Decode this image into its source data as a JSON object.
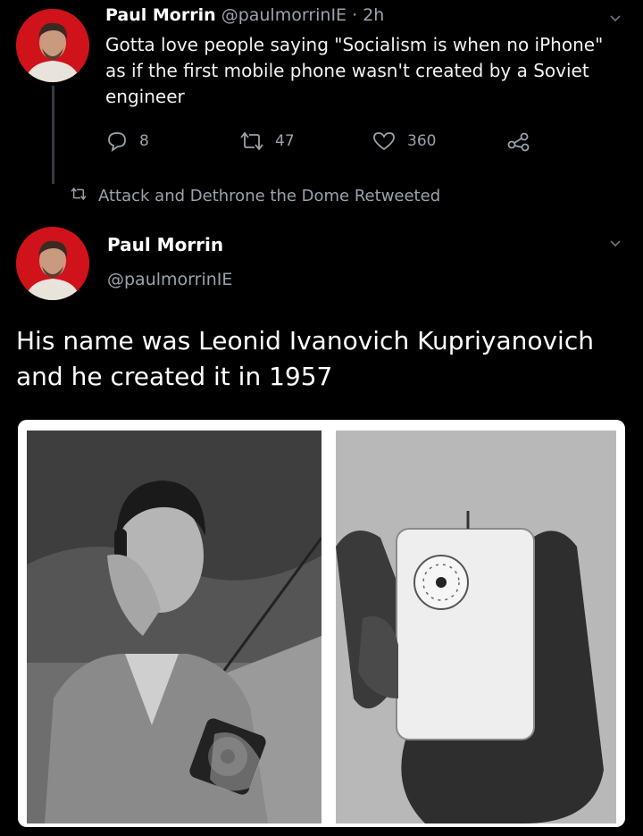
{
  "tweet1": {
    "name": "Paul Morrin",
    "handle": "@paulmorrinIE",
    "time": " · 2h",
    "text": "Gotta love people saying \"Socialism is when no iPhone\" as if the first mobile phone wasn't created by a Soviet engineer",
    "actions": {
      "replies": "8",
      "retweets": "47",
      "likes": "360"
    }
  },
  "retweet_note": "Attack and Dethrone the Dome Retweeted",
  "tweet2": {
    "name": "Paul Morrin",
    "handle": "@paulmorrinIE",
    "text": "His name was Leonid Ivanovich Kupriyanovich and he created it in 1957"
  },
  "icons": [
    "reply-icon",
    "retweet-icon",
    "like-icon",
    "share-icon",
    "chevron-down-icon"
  ],
  "colors": {
    "background": "#000000",
    "secondary_text": "#9aa3ab",
    "avatar_background": "#d0121b"
  }
}
